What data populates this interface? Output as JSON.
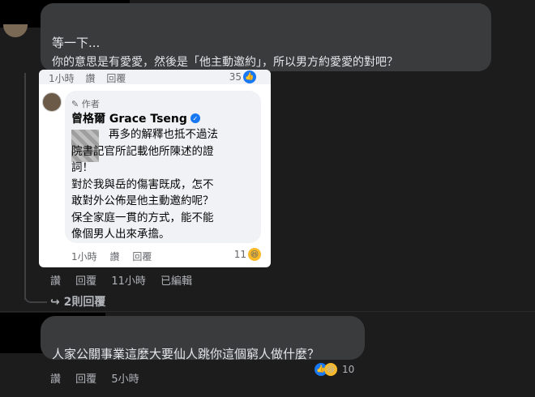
{
  "comment1": {
    "line1": "等一下...",
    "line2": "你的意思是有愛愛，然後是「他主動邀約」，所以男方約愛愛的對吧？",
    "actions": [
      "讚",
      "回覆",
      "11小時",
      "已編輯"
    ]
  },
  "embedded": {
    "top_actions": [
      "1小時",
      "讚",
      "回覆"
    ],
    "top_count": "35",
    "author_tag": "作者",
    "author_name": "曾格爾 Grace Tseng",
    "lines": [
      "再多的解釋也抵不過法",
      "院書記官所記載他所陳述的證",
      "詞！",
      "對於我與岳的傷害既成，怎不",
      "敢對外公佈是他主動邀約呢？",
      "保全家庭一貫的方式，能不能",
      "像個男人出來承擔。"
    ],
    "bottom_actions": [
      "1小時",
      "讚",
      "回覆"
    ],
    "reaction_count": "11"
  },
  "replies_link": "↪ 2則回覆",
  "comment2": {
    "text": "人家公關事業這麼大要仙人跳你這個窮人做什麼？",
    "actions": [
      "讚",
      "回覆",
      "5小時"
    ],
    "reaction_count": "10"
  },
  "colors": {
    "background": "#1c1c1d",
    "bubble": "#3a3b3c",
    "like_blue": "#1877f2",
    "haha_yellow": "#f7b928"
  }
}
